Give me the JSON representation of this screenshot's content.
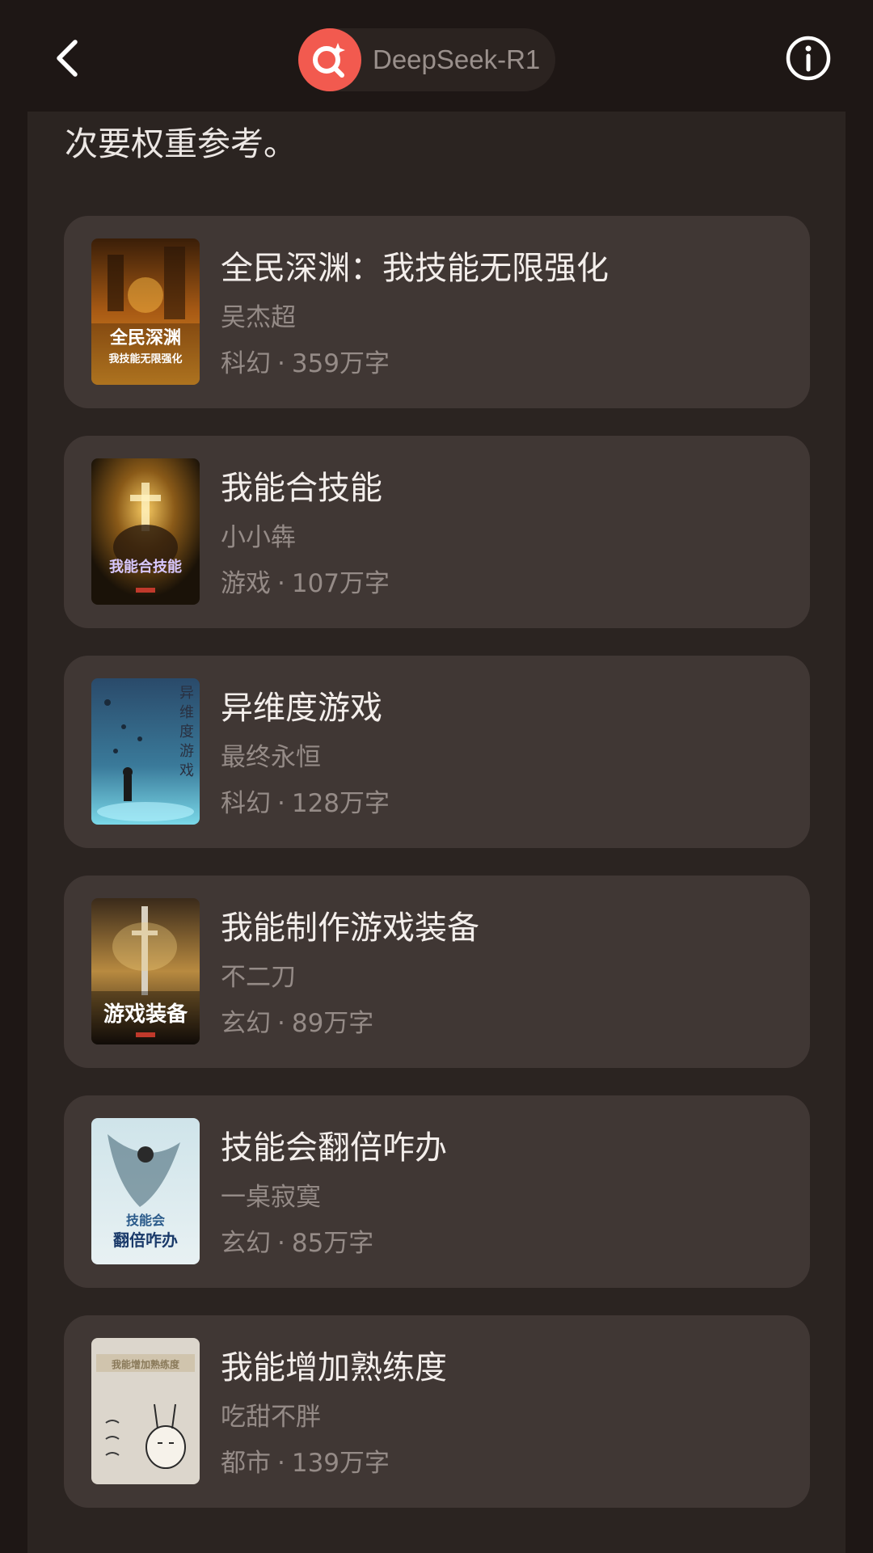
{
  "header": {
    "back_icon": "chevron-left-icon",
    "model_name": "DeepSeek-R1",
    "model_logo_icon": "search-sparkle-icon",
    "model_logo_color": "#f25a4f",
    "info_icon": "info-circle-icon"
  },
  "message": {
    "lead_text": "次要权重参考。"
  },
  "separator": "·",
  "books": [
    {
      "title": "全民深渊：我技能无限强化",
      "author": "吴杰超",
      "genre": "科幻",
      "words": "359万字",
      "cover_text": "全民深渊",
      "cover_subtext": "我技能无限强化"
    },
    {
      "title": "我能合技能",
      "author": "小小犇",
      "genre": "游戏",
      "words": "107万字",
      "cover_text": "我能合技能"
    },
    {
      "title": "异维度游戏",
      "author": "最终永恒",
      "genre": "科幻",
      "words": "128万字",
      "cover_text": "异维度游戏"
    },
    {
      "title": "我能制作游戏装备",
      "author": "不二刀",
      "genre": "玄幻",
      "words": "89万字",
      "cover_text": "游戏装备"
    },
    {
      "title": "技能会翻倍咋办",
      "author": "一桌寂寞",
      "genre": "玄幻",
      "words": "85万字",
      "cover_text": "技能会",
      "cover_subtext": "翻倍咋办"
    },
    {
      "title": "我能增加熟练度",
      "author": "吃甜不胖",
      "genre": "都市",
      "words": "139万字",
      "cover_text": "我能增加熟练度"
    }
  ],
  "colors": {
    "background": "#1e1715",
    "panel": "#2b2421",
    "card": "#403734",
    "title_text": "#f3eeeb",
    "secondary_text": "#958b87",
    "accent": "#f25a4f"
  }
}
